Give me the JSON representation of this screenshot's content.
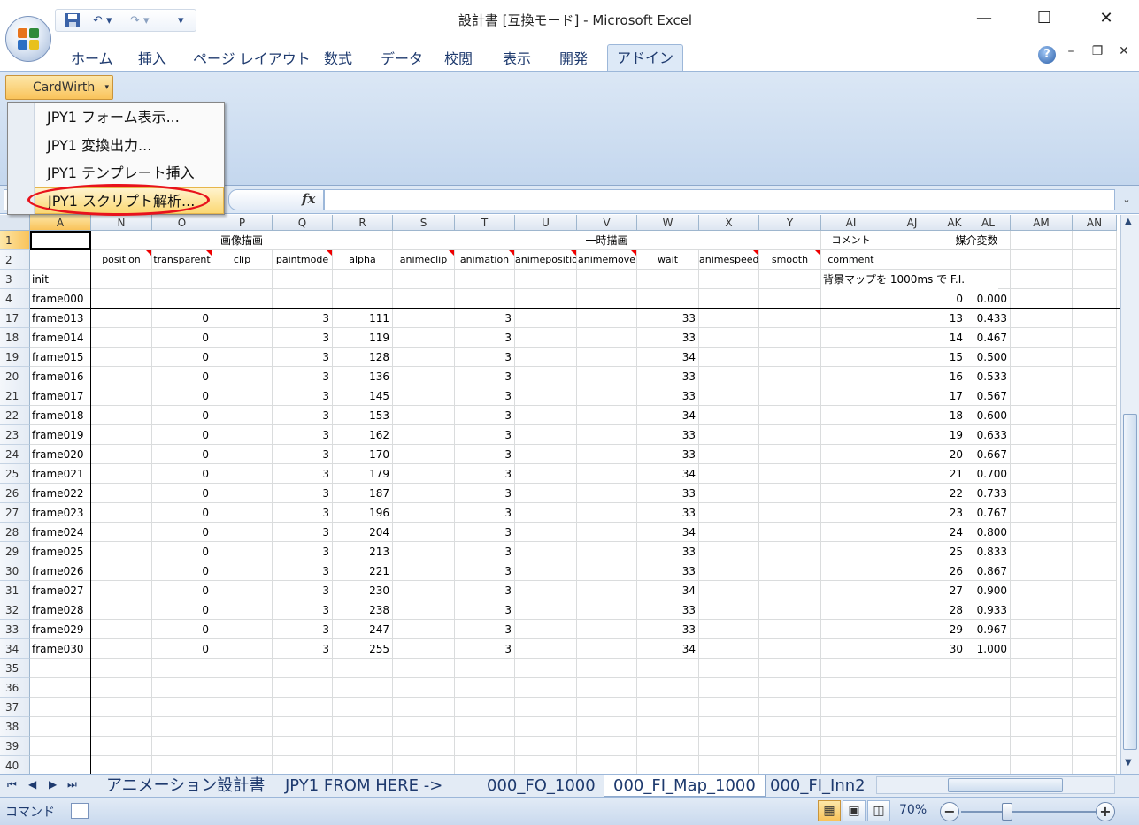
{
  "window": {
    "title": "設計書 [互換モード] - Microsoft Excel",
    "minimize_glyph": "—",
    "maximize_glyph": "☐",
    "close_glyph": "✕"
  },
  "qat": {
    "save_icon": "save-icon",
    "undo_glyph": "↶ ▾",
    "redo_glyph": "↷ ▾",
    "customize_glyph": "▾"
  },
  "ribbon": {
    "tabs": [
      "ホーム",
      "挿入",
      "ページ レイアウト",
      "数式",
      "データ",
      "校閲",
      "表示",
      "開発",
      "アドイン"
    ],
    "active_tab": "アドイン",
    "addin_button": "CardWirth",
    "addin_arrow": "▾",
    "help_glyph": "?",
    "mdi_min": "–",
    "mdi_restore": "❐",
    "mdi_close": "✕"
  },
  "menu": {
    "items": [
      "JPY1 フォーム表示...",
      "JPY1 変換出力...",
      "JPY1 テンプレート挿入",
      "JPY1 スクリプト解析..."
    ],
    "highlighted_index": 3,
    "highlight_ring_color": "#e8121c"
  },
  "formula_bar": {
    "fx": "fx",
    "expand_glyph": "⌄",
    "content": ""
  },
  "sheet": {
    "columns": [
      "A",
      "N",
      "O",
      "P",
      "Q",
      "R",
      "S",
      "T",
      "U",
      "V",
      "W",
      "X",
      "Y",
      "AI",
      "AJ",
      "AK",
      "AL",
      "AM",
      "AN"
    ],
    "group_headers": {
      "image": "画像描画",
      "temp": "一時描画",
      "comment": "コメント",
      "media": "媒介変数"
    },
    "params": [
      "position",
      "transparent",
      "clip",
      "paintmode",
      "alpha",
      "animeclip",
      "animation",
      "animeposition",
      "animemove",
      "wait",
      "animespeed",
      "smooth",
      "comment"
    ],
    "row3": {
      "label": "init",
      "note": "背景マップを 1000ms で F.I."
    },
    "row4": {
      "label": "frame000",
      "ak": "0",
      "al": "0.000"
    },
    "rows": [
      {
        "num": "17",
        "label": "frame013",
        "o": "0",
        "q": "3",
        "r": "111",
        "t": "3",
        "w": "33",
        "ak": "13",
        "al": "0.433"
      },
      {
        "num": "18",
        "label": "frame014",
        "o": "0",
        "q": "3",
        "r": "119",
        "t": "3",
        "w": "33",
        "ak": "14",
        "al": "0.467"
      },
      {
        "num": "19",
        "label": "frame015",
        "o": "0",
        "q": "3",
        "r": "128",
        "t": "3",
        "w": "34",
        "ak": "15",
        "al": "0.500"
      },
      {
        "num": "20",
        "label": "frame016",
        "o": "0",
        "q": "3",
        "r": "136",
        "t": "3",
        "w": "33",
        "ak": "16",
        "al": "0.533"
      },
      {
        "num": "21",
        "label": "frame017",
        "o": "0",
        "q": "3",
        "r": "145",
        "t": "3",
        "w": "33",
        "ak": "17",
        "al": "0.567"
      },
      {
        "num": "22",
        "label": "frame018",
        "o": "0",
        "q": "3",
        "r": "153",
        "t": "3",
        "w": "34",
        "ak": "18",
        "al": "0.600"
      },
      {
        "num": "23",
        "label": "frame019",
        "o": "0",
        "q": "3",
        "r": "162",
        "t": "3",
        "w": "33",
        "ak": "19",
        "al": "0.633"
      },
      {
        "num": "24",
        "label": "frame020",
        "o": "0",
        "q": "3",
        "r": "170",
        "t": "3",
        "w": "33",
        "ak": "20",
        "al": "0.667"
      },
      {
        "num": "25",
        "label": "frame021",
        "o": "0",
        "q": "3",
        "r": "179",
        "t": "3",
        "w": "34",
        "ak": "21",
        "al": "0.700"
      },
      {
        "num": "26",
        "label": "frame022",
        "o": "0",
        "q": "3",
        "r": "187",
        "t": "3",
        "w": "33",
        "ak": "22",
        "al": "0.733"
      },
      {
        "num": "27",
        "label": "frame023",
        "o": "0",
        "q": "3",
        "r": "196",
        "t": "3",
        "w": "33",
        "ak": "23",
        "al": "0.767"
      },
      {
        "num": "28",
        "label": "frame024",
        "o": "0",
        "q": "3",
        "r": "204",
        "t": "3",
        "w": "34",
        "ak": "24",
        "al": "0.800"
      },
      {
        "num": "29",
        "label": "frame025",
        "o": "0",
        "q": "3",
        "r": "213",
        "t": "3",
        "w": "33",
        "ak": "25",
        "al": "0.833"
      },
      {
        "num": "30",
        "label": "frame026",
        "o": "0",
        "q": "3",
        "r": "221",
        "t": "3",
        "w": "33",
        "ak": "26",
        "al": "0.867"
      },
      {
        "num": "31",
        "label": "frame027",
        "o": "0",
        "q": "3",
        "r": "230",
        "t": "3",
        "w": "34",
        "ak": "27",
        "al": "0.900"
      },
      {
        "num": "32",
        "label": "frame028",
        "o": "0",
        "q": "3",
        "r": "238",
        "t": "3",
        "w": "33",
        "ak": "28",
        "al": "0.933"
      },
      {
        "num": "33",
        "label": "frame029",
        "o": "0",
        "q": "3",
        "r": "247",
        "t": "3",
        "w": "33",
        "ak": "29",
        "al": "0.967"
      },
      {
        "num": "34",
        "label": "frame030",
        "o": "0",
        "q": "3",
        "r": "255",
        "t": "3",
        "w": "34",
        "ak": "30",
        "al": "1.000"
      }
    ],
    "empty_rows": [
      "35",
      "36",
      "37",
      "38",
      "39",
      "40"
    ],
    "first_rows": [
      "1",
      "2",
      "3",
      "4"
    ]
  },
  "sheet_tabs": {
    "nav": [
      "⏮",
      "◀",
      "▶",
      "⏭"
    ],
    "tabs": [
      "アニメーション設計書",
      "JPY1 FROM HERE ->",
      "000_FO_1000",
      "000_FI_Map_1000",
      "000_FI_Inn2"
    ],
    "active_index": 3
  },
  "status": {
    "mode": "コマンド",
    "zoom": "70%",
    "zoom_out": "−",
    "zoom_in": "+",
    "view_normal": "▦",
    "view_layout": "▣",
    "view_break": "◫"
  },
  "colors": {
    "ribbon": "#dbe7f5",
    "accent_orange": "#f9c35a",
    "ring_red": "#e8121c"
  }
}
